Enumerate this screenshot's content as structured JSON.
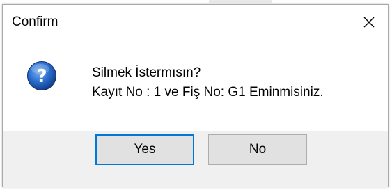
{
  "dialog": {
    "title": "Confirm",
    "close_icon": "close-icon",
    "icon": "question-icon",
    "message_line1": "Silmek İstermısın?",
    "message_line2": "Kayıt No : 1 ve Fiş No: G1 Eminmisiniz.",
    "buttons": {
      "yes_label": "Yes",
      "no_label": "No"
    }
  },
  "colors": {
    "default_button_border": "#0078d7",
    "button_face": "#e1e1e1",
    "footer_background": "#f0f0f0",
    "icon_blue": "#1e5fbf"
  }
}
